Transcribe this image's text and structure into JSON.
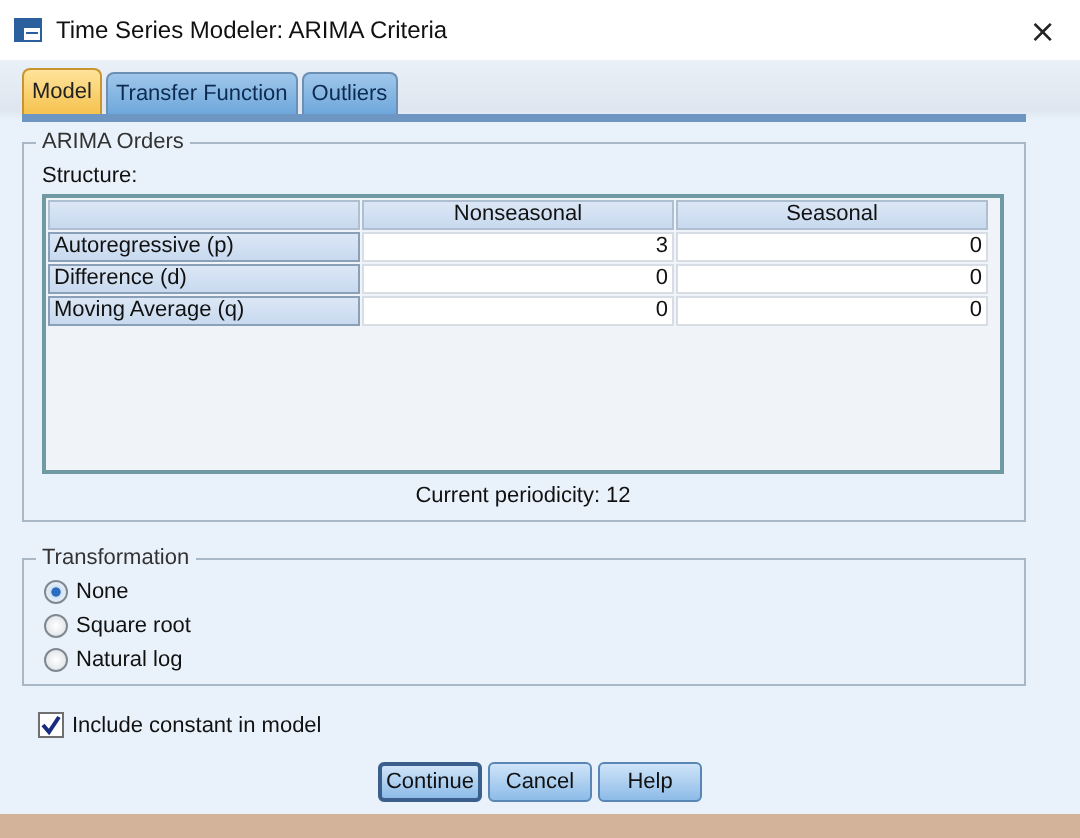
{
  "window": {
    "title": "Time Series Modeler: ARIMA Criteria",
    "close": "×"
  },
  "tabs": [
    {
      "label": "Model",
      "selected": true
    },
    {
      "label": "Transfer Function",
      "selected": false
    },
    {
      "label": "Outliers",
      "selected": false
    }
  ],
  "arima_orders": {
    "title": "ARIMA Orders",
    "structure_label": "Structure:",
    "table": {
      "columns": [
        "Nonseasonal",
        "Seasonal"
      ],
      "rows": [
        {
          "label": "Autoregressive (p)",
          "values": [
            "3",
            "0"
          ]
        },
        {
          "label": "Difference (d)",
          "values": [
            "0",
            "0"
          ]
        },
        {
          "label": "Moving Average (q)",
          "values": [
            "0",
            "0"
          ]
        }
      ]
    },
    "periodicity": "Current periodicity: 12"
  },
  "transformation": {
    "title": "Transformation",
    "options": [
      {
        "label": "None",
        "selected": true
      },
      {
        "label": "Square root",
        "selected": false
      },
      {
        "label": "Natural log",
        "selected": false
      }
    ]
  },
  "include_constant": {
    "label": "Include constant in model",
    "checked": true
  },
  "buttons": [
    {
      "label": "Continue",
      "default": true
    },
    {
      "label": "Cancel",
      "default": false
    },
    {
      "label": "Help",
      "default": false
    }
  ]
}
